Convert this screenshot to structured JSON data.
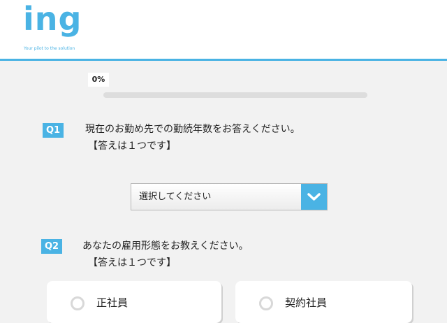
{
  "header": {
    "logo_text": "ing",
    "tagline": "Your pilot to the solution"
  },
  "progress": {
    "label": "0%",
    "fraction": 0
  },
  "colors": {
    "accent": "#4ab3e4",
    "background": "#f2f2f2"
  },
  "q1": {
    "badge": "Q1",
    "question": "現在のお勤め先での勤続年数をお答えください。",
    "note": "【答えは１つです】",
    "select": {
      "value": "選択してください",
      "icon": "chevron-down-icon"
    }
  },
  "q2": {
    "badge": "Q2",
    "question": "あなたの雇用形態をお教えください。",
    "note": "【答えは１つです】",
    "options": [
      {
        "label": "正社員"
      },
      {
        "label": "契約社員"
      }
    ]
  }
}
